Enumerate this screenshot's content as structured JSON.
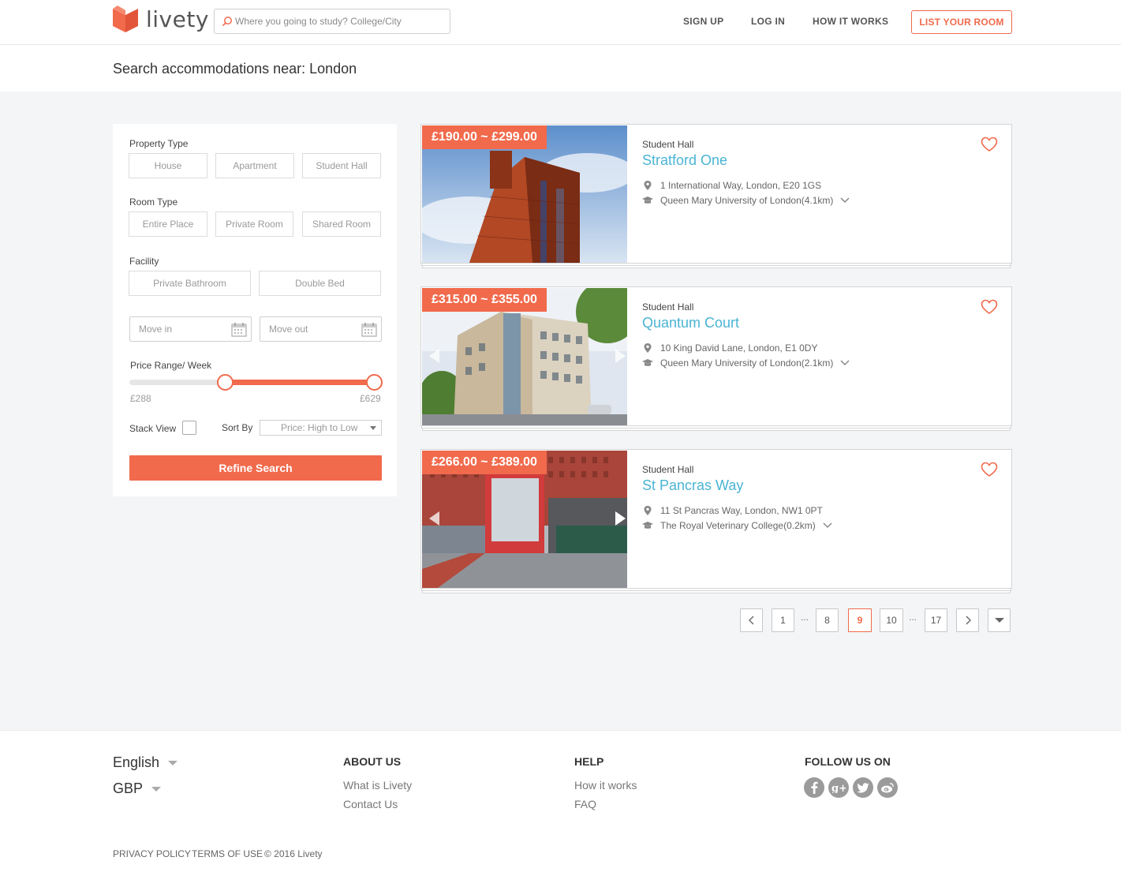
{
  "header": {
    "brand": "livety",
    "search_placeholder": "Where you going to study? College/City",
    "nav": {
      "signup": "SIGN UP",
      "login": "LOG IN",
      "how_it_works": "HOW IT WORKS"
    },
    "list_room": "LIST YOUR ROOM"
  },
  "page_title": "Search accommodations near: London",
  "filters": {
    "property_type_label": "Property Type",
    "property_types": [
      "House",
      "Apartment",
      "Student Hall"
    ],
    "room_type_label": "Room Type",
    "room_types": [
      "Entire Place",
      "Private Room",
      "Shared Room"
    ],
    "facility_label": "Facility",
    "facilities": [
      "Private Bathroom",
      "Double Bed"
    ],
    "move_in_placeholder": "Move in",
    "move_out_placeholder": "Move out",
    "price_range_label": "Price Range/ Week",
    "price_min": "£288",
    "price_max": "£629",
    "slider_low_fraction": 0.38,
    "slider_high_fraction": 0.97,
    "stack_view_label": "Stack View",
    "sort_by_label": "Sort By",
    "sort_value": "Price: High to Low",
    "refine_button": "Refine Search"
  },
  "listings": [
    {
      "price": "£190.00 ~ £299.00",
      "type": "Student Hall",
      "name": "Stratford One",
      "address": "1 International Way, London, E20 1GS",
      "university": "Queen Mary University of London(4.1km)"
    },
    {
      "price": "£315.00 ~ £355.00",
      "type": "Student Hall",
      "name": "Quantum Court",
      "address": "10 King David Lane, London, E1 0DY",
      "university": "Queen Mary University of London(2.1km)"
    },
    {
      "price": "£266.00 ~ £389.00",
      "type": "Student Hall",
      "name": "St Pancras Way",
      "address": "11 St Pancras Way, London, NW1 0PT",
      "university": "The Royal Veterinary College(0.2km)"
    }
  ],
  "pagination": {
    "first": "1",
    "dots": "...",
    "prev_page": "8",
    "current": "9",
    "next_page": "10",
    "last": "17"
  },
  "footer": {
    "language": "English",
    "currency": "GBP",
    "about_heading": "ABOUT US",
    "about_links": [
      "What is Livety",
      "Contact Us"
    ],
    "help_heading": "HELP",
    "help_links": [
      "How it works",
      "FAQ"
    ],
    "follow_heading": "FOLLOW US ON",
    "social_icons": [
      "facebook-icon",
      "google-plus-icon",
      "twitter-icon",
      "weibo-icon"
    ],
    "legal": {
      "privacy": "PRIVACY POLICY",
      "terms": "TERMS OF USE",
      "copyright": "© 2016 Livety"
    }
  },
  "colors": {
    "accent": "#f16a4c",
    "link": "#4bb4d4",
    "background": "#f4f5f7"
  }
}
